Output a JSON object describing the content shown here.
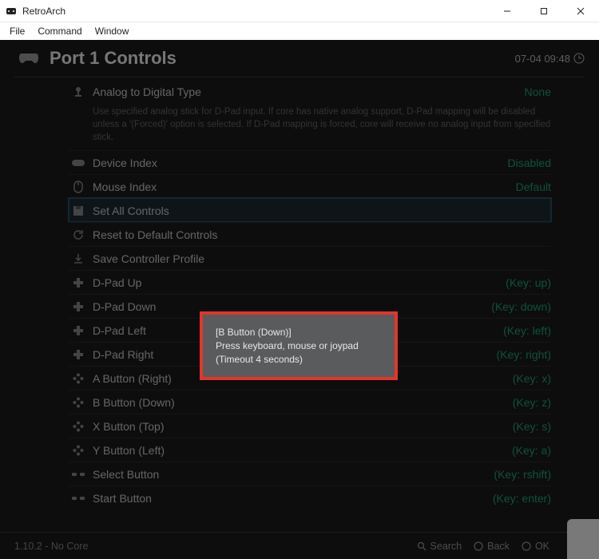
{
  "window": {
    "title": "RetroArch"
  },
  "menubar": {
    "file": "File",
    "command": "Command",
    "window": "Window"
  },
  "header": {
    "title": "Port 1 Controls",
    "clock": "07-04 09:48"
  },
  "helptext": "Use specified analog stick for D-Pad input. If core has native analog support, D-Pad mapping will be disabled unless a '(Forced)' option is selected. If D-Pad mapping is forced, core will receive no analog input from specified stick.",
  "rows": {
    "analog_digital": {
      "label": "Analog to Digital Type",
      "value": "None"
    },
    "device_index": {
      "label": "Device Index",
      "value": "Disabled"
    },
    "mouse_index": {
      "label": "Mouse Index",
      "value": "Default"
    },
    "set_all": {
      "label": "Set All Controls",
      "value": ""
    },
    "reset_default": {
      "label": "Reset to Default Controls",
      "value": ""
    },
    "save_profile": {
      "label": "Save Controller Profile",
      "value": ""
    },
    "dpad_up": {
      "label": "D-Pad Up",
      "value": "(Key: up)"
    },
    "dpad_down": {
      "label": "D-Pad Down",
      "value": "(Key: down)"
    },
    "dpad_left": {
      "label": "D-Pad Left",
      "value": "(Key: left)"
    },
    "dpad_right": {
      "label": "D-Pad Right",
      "value": "(Key: right)"
    },
    "a_button": {
      "label": "A Button (Right)",
      "value": "(Key: x)"
    },
    "b_button": {
      "label": "B Button (Down)",
      "value": "(Key: z)"
    },
    "x_button": {
      "label": "X Button (Top)",
      "value": "(Key: s)"
    },
    "y_button": {
      "label": "Y Button (Left)",
      "value": "(Key: a)"
    },
    "select_button": {
      "label": "Select Button",
      "value": "(Key: rshift)"
    },
    "start_button": {
      "label": "Start Button",
      "value": "(Key: enter)"
    }
  },
  "modal": {
    "line1": "[B Button (Down)]",
    "line2": "Press keyboard, mouse or joypad",
    "line3": "(Timeout 4 seconds)"
  },
  "footer": {
    "version": "1.10.2 - No Core",
    "search": "Search",
    "back": "Back",
    "ok": "OK"
  }
}
